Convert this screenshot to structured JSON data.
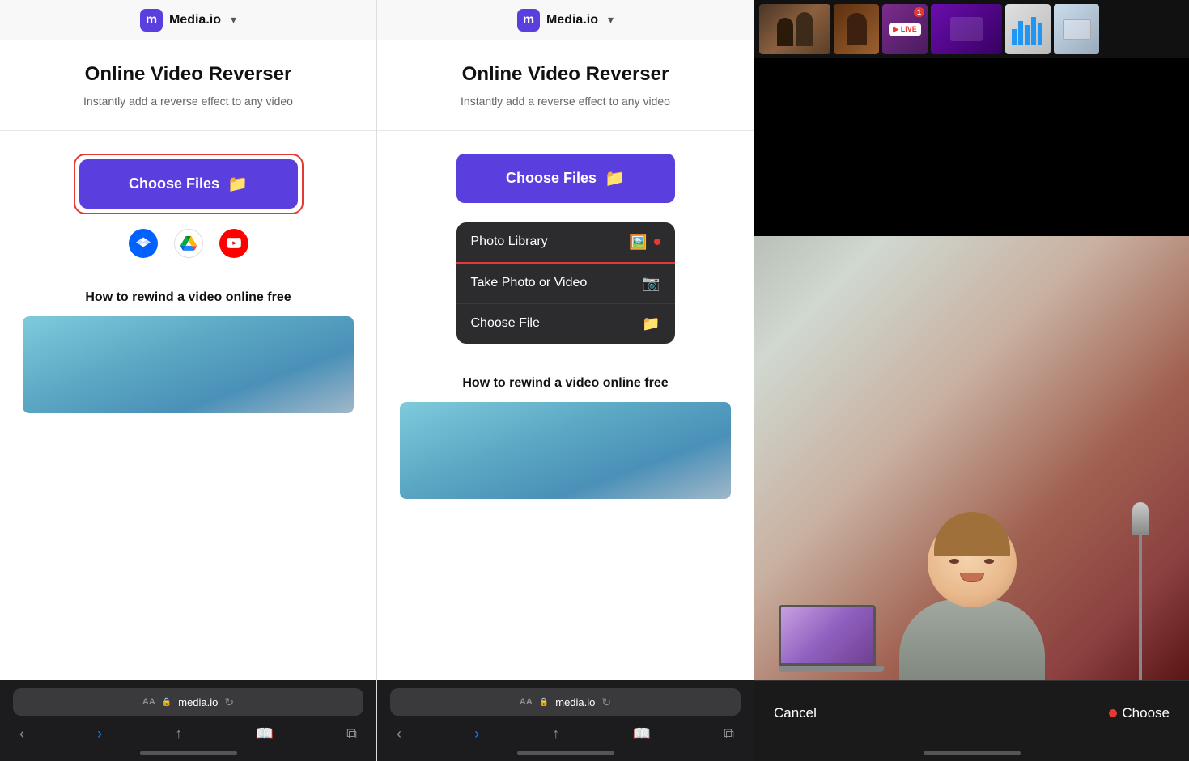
{
  "panel1": {
    "logo_letter": "m",
    "site_name": "Media.io",
    "page_title": "Online Video Reverser",
    "page_subtitle": "Instantly add a reverse effect to any video",
    "choose_files_label": "Choose Files",
    "how_to_title": "How to rewind a video online free",
    "url_aa": "AA",
    "url_domain": "media.io"
  },
  "panel2": {
    "logo_letter": "m",
    "site_name": "Media.io",
    "page_title": "Online Video Reverser",
    "page_subtitle": "Instantly add a reverse effect to any video",
    "choose_files_label": "Choose Files",
    "dropdown": {
      "items": [
        {
          "label": "Photo Library",
          "icon": "🖼️"
        },
        {
          "label": "Take Photo or Video",
          "icon": "📷"
        },
        {
          "label": "Choose File",
          "icon": "📁"
        }
      ]
    },
    "how_to_title": "How to rewind a video online free",
    "url_aa": "AA",
    "url_domain": "media.io"
  },
  "right_panel": {
    "cancel_label": "Cancel",
    "choose_label": "Choose"
  }
}
